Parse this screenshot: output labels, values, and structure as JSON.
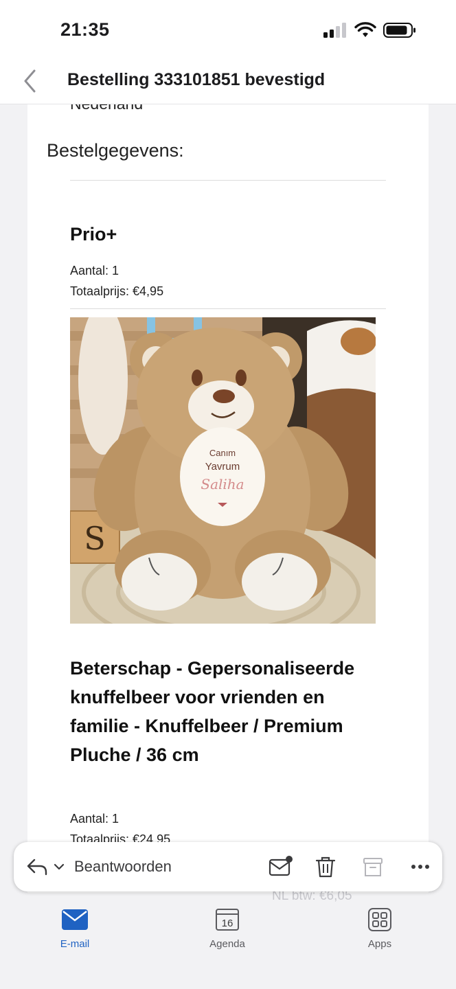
{
  "status_bar": {
    "time": "21:35"
  },
  "nav": {
    "title": "Bestelling 333101851 bevestigd"
  },
  "email": {
    "cut_off_top_text": "Nederland",
    "section_title": "Bestelgegevens:",
    "items": [
      {
        "name": "Prio+",
        "quantity_label": "Aantal: 1",
        "total_label": "Totaalprijs: €4,95"
      },
      {
        "image_text": {
          "line1": "Canım",
          "line2": "Yavrum",
          "line3": "Saliha",
          "block_letter": "S"
        },
        "name": "Beterschap - Gepersonaliseerde knuffelbeer voor vrienden en familie - Knuffelbeer / Premium Pluche / 36 cm",
        "quantity_label": "Aantal: 1",
        "total_label": "Totaalprijs: €24,95"
      }
    ],
    "behind_toolbar_text": "NL btw: €6,05"
  },
  "reply_bar": {
    "reply_label": "Beantwoorden"
  },
  "tabs": [
    {
      "label": "E-mail",
      "icon": "mail-icon",
      "active": true
    },
    {
      "label": "Agenda",
      "icon": "calendar-icon",
      "day": "16",
      "active": false
    },
    {
      "label": "Apps",
      "icon": "apps-icon",
      "active": false
    }
  ],
  "colors": {
    "accent": "#1f62c2",
    "background": "#f2f2f4",
    "card": "#ffffff"
  }
}
